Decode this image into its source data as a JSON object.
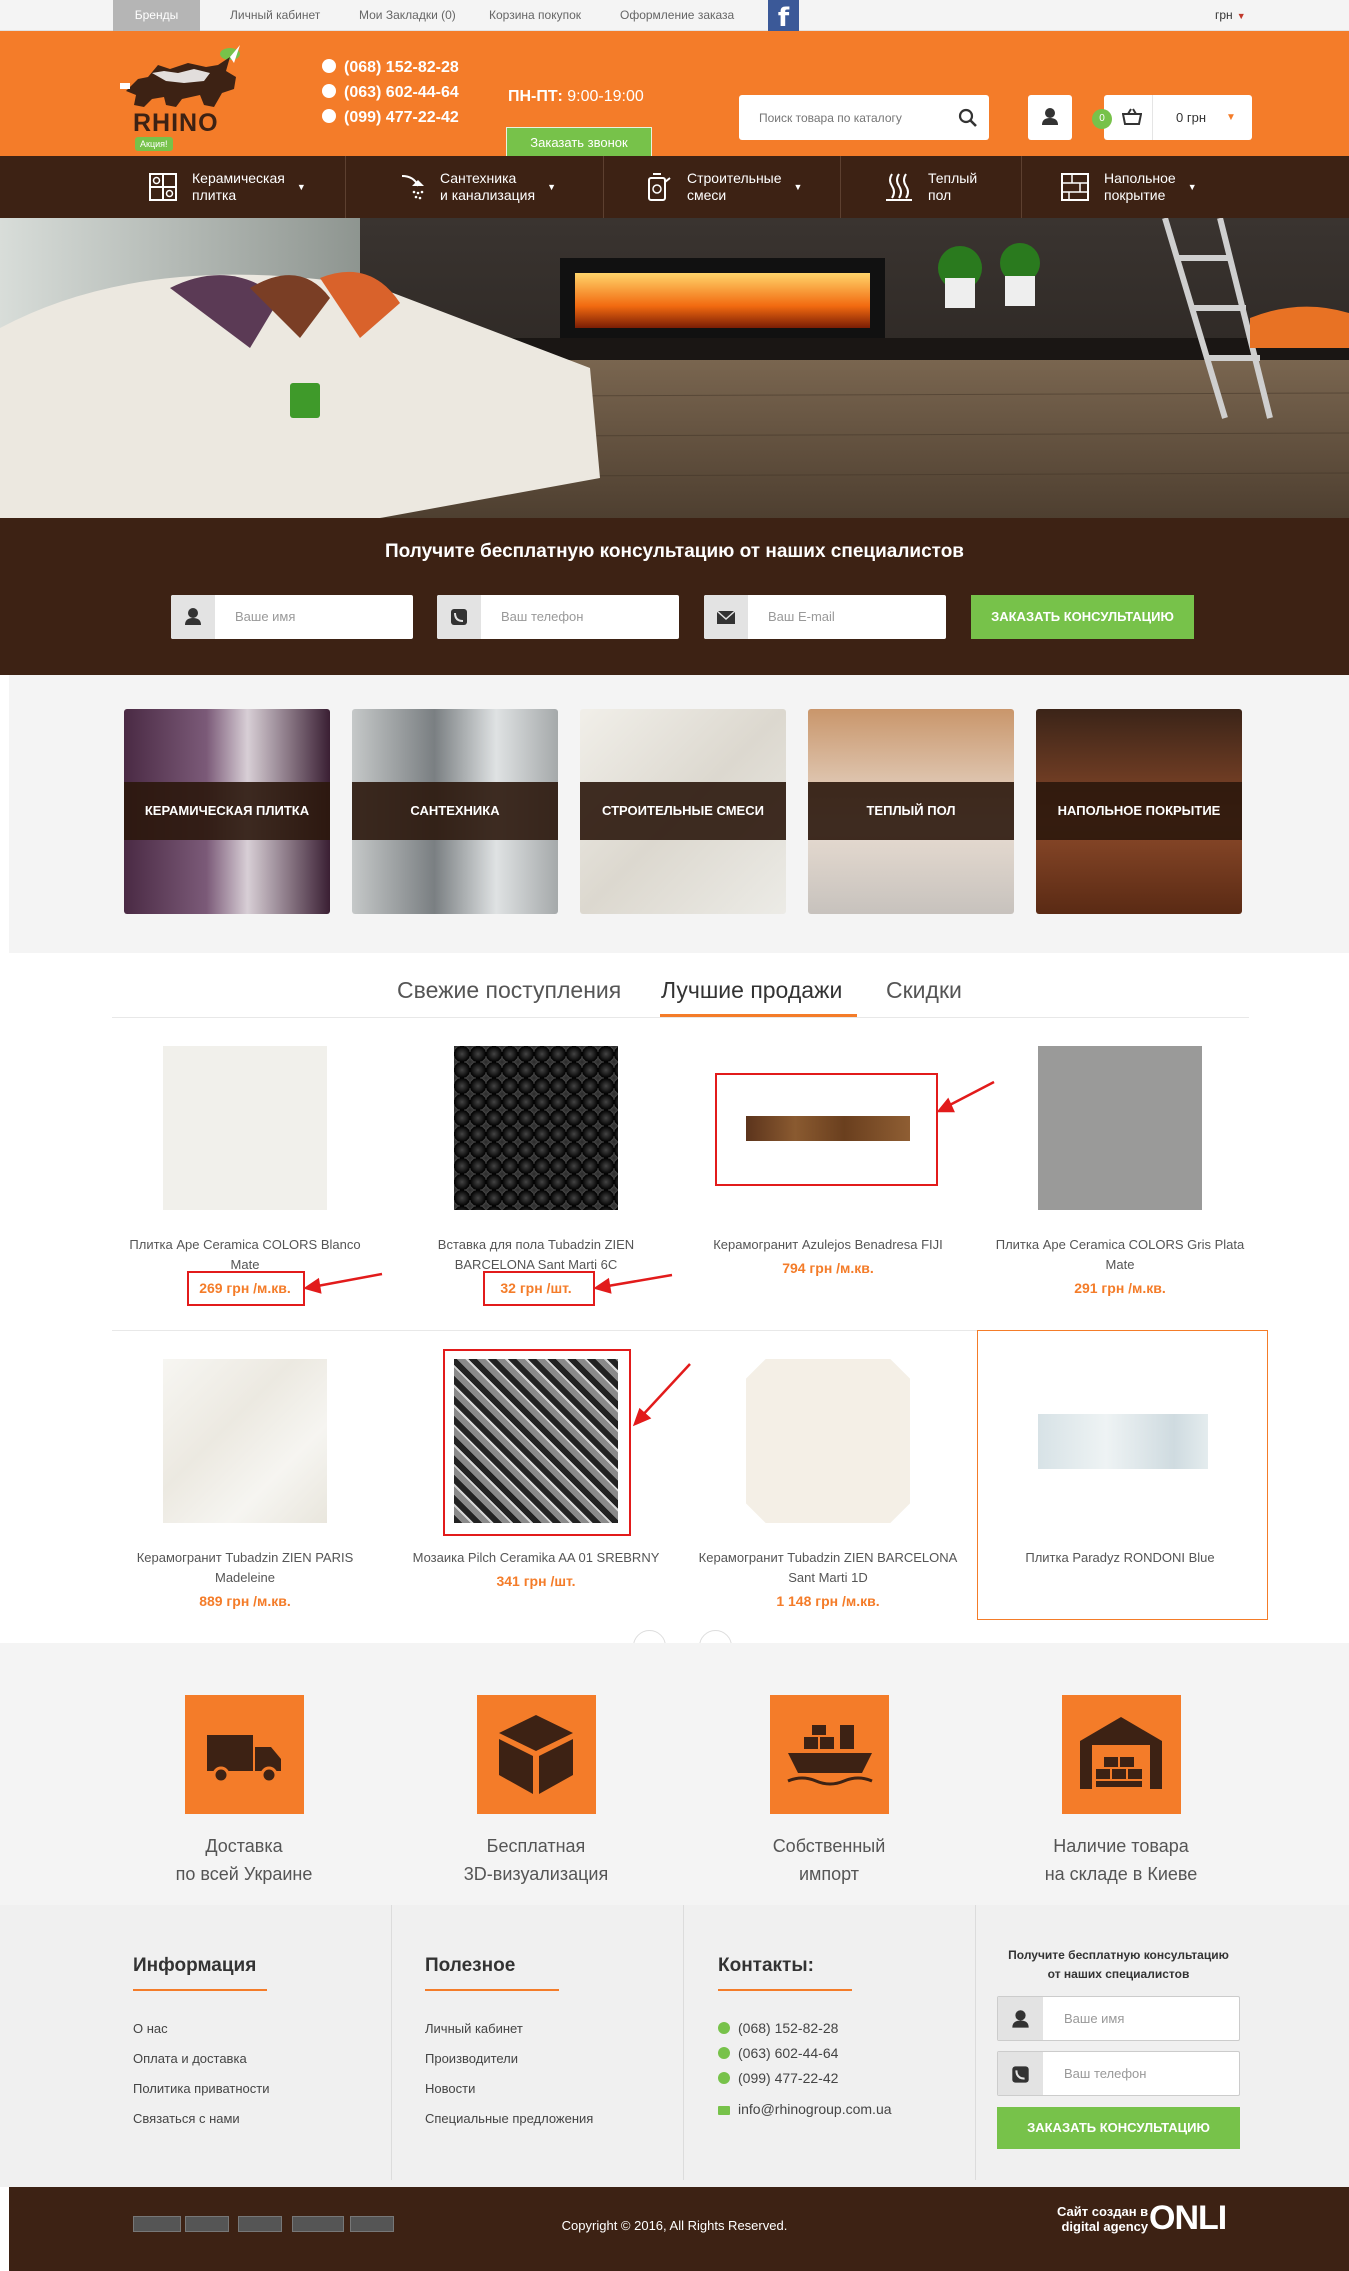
{
  "topbar": {
    "links": [
      "Бренды",
      "Личный кабинет",
      "Мои Закладки (0)",
      "Корзина покупок",
      "Оформление заказа"
    ],
    "facebook_icon": "f",
    "currency": "грн"
  },
  "header": {
    "logo_text": "RHINO",
    "logo_badge": "Акция!",
    "phones": [
      "(068) 152-82-28",
      "(063) 602-44-64",
      "(099) 477-22-42"
    ],
    "hours_label": "ПН-ПТ:",
    "hours_value": " 9:00-19:00",
    "callback_label": "Заказать звонок",
    "search_placeholder": "Поиск товара по каталогу",
    "cart_count": "0",
    "cart_total": "0 грн"
  },
  "nav": {
    "items": [
      {
        "label": "Керамическая\nплитка",
        "icon": "tile-icon"
      },
      {
        "label": "Сантехника\nи канализация",
        "icon": "shower-icon"
      },
      {
        "label": "Строительные\nсмеси",
        "icon": "bucket-icon"
      },
      {
        "label": "Теплый\nпол",
        "icon": "heat-icon"
      },
      {
        "label": "Напольное\nпокрытие",
        "icon": "floor-icon"
      }
    ]
  },
  "consult": {
    "title": "Получите бесплатную консультацию от наших специалистов",
    "name_placeholder": "Ваше имя",
    "phone_placeholder": "Ваш телефон",
    "email_placeholder": "Ваш E-mail",
    "button": "ЗАКАЗАТЬ КОНСУЛЬТАЦИЮ"
  },
  "categories": [
    "КЕРАМИЧЕСКАЯ ПЛИТКА",
    "САНТЕХНИКА",
    "СТРОИТЕЛЬНЫЕ СМЕСИ",
    "ТЕПЛЫЙ ПОЛ",
    "НАПОЛЬНОЕ ПОКРЫТИЕ"
  ],
  "tabs": [
    "Свежие поступления",
    "Лучшие продажи",
    "Скидки"
  ],
  "tabs_active": "Лучшие продажи",
  "products": [
    {
      "name": "Плитка Ape Ceramica COLORS Blanco\nMate",
      "price": "269 грн /м.кв."
    },
    {
      "name": "Вставка для пола Tubadzin ZIEN\nBARCELONA Sant Marti 6C",
      "price": "32 грн /шт."
    },
    {
      "name": "Керамогранит Azulejos Benadresa FIJI",
      "price": "794 грн /м.кв."
    },
    {
      "name": "Плитка Ape Ceramica COLORS Gris Plata\nMate",
      "price": "291 грн /м.кв."
    },
    {
      "name": "Керамогранит Tubadzin ZIEN PARIS\nMadeleine",
      "price": "889 грн /м.кв."
    },
    {
      "name": "Мозаика Pilch Ceramika AA 01 SREBRNY",
      "price": "341 грн /шт."
    },
    {
      "name": "Керамогранит Tubadzin ZIEN BARCELONA\nSant Marti 1D",
      "price": "1 148 грн /м.кв."
    },
    {
      "name": "Плитка Paradyz RONDONI Blue",
      "price": ""
    }
  ],
  "features": [
    {
      "text": "Доставка\nпо всей Украине",
      "icon": "truck-icon"
    },
    {
      "text": "Бесплатная\n3D-визуализация",
      "icon": "cube-icon"
    },
    {
      "text": "Собственный\nимпорт",
      "icon": "ship-icon"
    },
    {
      "text": "Наличие товара\nна складе в Киеве",
      "icon": "warehouse-icon"
    }
  ],
  "footer": {
    "info_title": "Информация",
    "info_links": [
      "О нас",
      "Оплата и доставка",
      "Политика приватности",
      "Связаться с нами"
    ],
    "useful_title": "Полезное",
    "useful_links": [
      "Личный кабинет",
      "Производители",
      "Новости",
      "Специальные предложения"
    ],
    "contacts_title": "Контакты:",
    "contacts": [
      "(068) 152-82-28",
      "(063) 602-44-64",
      "(099) 477-22-42",
      "info@rhinogroup.com.ua"
    ],
    "consult_title": "Получите бесплатную консультацию\nот наших специалистов",
    "name_placeholder": "Ваше имя",
    "phone_placeholder": "Ваш телефон",
    "button": "ЗАКАЗАТЬ КОНСУЛЬТАЦИЮ"
  },
  "bottom": {
    "copyright": "Copyright © 2016, All Rights Reserved.",
    "site_by": "Сайт создан в\ndigital agency",
    "agency": "ONLI"
  },
  "colors": {
    "accent": "#f47c29",
    "dark": "#3d2214",
    "green": "#77c24a",
    "annotation": "#e21b1b"
  }
}
